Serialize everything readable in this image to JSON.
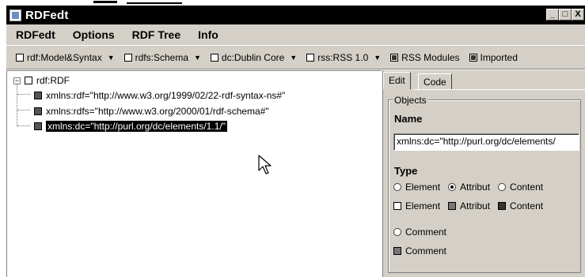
{
  "window": {
    "title": "RDFedt",
    "controls": [
      "_",
      "□",
      "X"
    ]
  },
  "menu": [
    "RDFedt",
    "Options",
    "RDF Tree",
    "Info"
  ],
  "toolbar": [
    {
      "label": "rdf:Model&Syntax",
      "checked": false,
      "dropdown": true
    },
    {
      "label": "rdfs:Schema",
      "checked": false,
      "dropdown": true
    },
    {
      "label": "dc:Dublin Core",
      "checked": false,
      "dropdown": true
    },
    {
      "label": "rss:RSS 1.0",
      "checked": false,
      "dropdown": true
    },
    {
      "label": "RSS Modules",
      "checked": true,
      "dropdown": false
    },
    {
      "label": "Imported",
      "checked": true,
      "dropdown": false
    }
  ],
  "tree": {
    "root": "rdf:RDF",
    "children": [
      "xmlns:rdf=\"http://www.w3.org/1999/02/22-rdf-syntax-ns#\"",
      "xmlns:rdfs=\"http://www.w3.org/2000/01/rdf-schema#\"",
      "xmlns:dc=\"http://purl.org/dc/elements/1.1/\""
    ],
    "selected_index": 2
  },
  "panel": {
    "tabs": [
      "Edit",
      "Code"
    ],
    "active_tab": "Edit",
    "group_label": "Objects",
    "name_label": "Name",
    "name_value": "xmlns:dc=\"http://purl.org/dc/elements/",
    "type_label": "Type",
    "radios": [
      {
        "label": "Element",
        "checked": false
      },
      {
        "label": "Attribut",
        "checked": true
      },
      {
        "label": "Content",
        "checked": false
      }
    ],
    "boxes": [
      {
        "label": "Element",
        "style": "empty"
      },
      {
        "label": "Attribut",
        "style": "gray"
      },
      {
        "label": "Content",
        "style": "dark"
      }
    ],
    "comment_radio": {
      "label": "Comment",
      "checked": false
    },
    "comment_box": {
      "label": "Comment",
      "style": "gray"
    }
  }
}
